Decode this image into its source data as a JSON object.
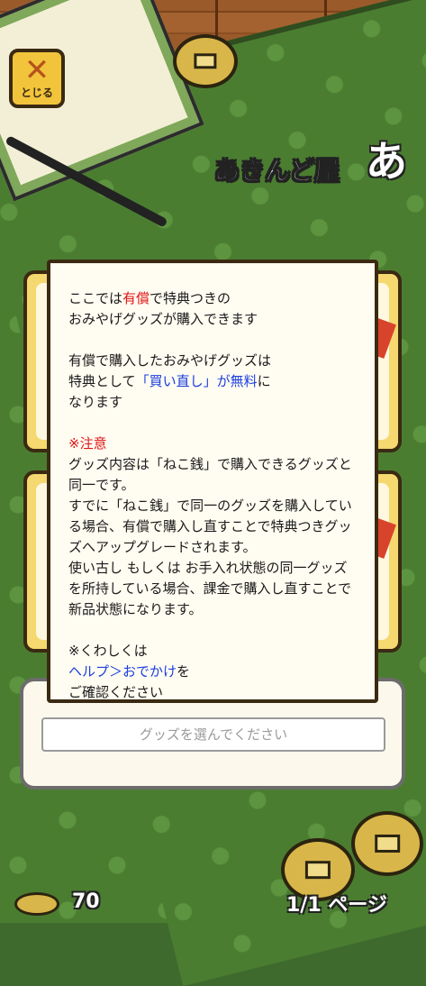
{
  "header": {
    "close_label": "とじる",
    "shop_title": "あきんど屋",
    "shop_logo": "あ"
  },
  "dialog": {
    "line1_a": "ここでは",
    "line1_red": "有償",
    "line1_b": "で特典つきの",
    "line2": "おみやげグッズが購入できます",
    "para2_line1": "有償で購入したおみやげグッズは",
    "para2_line2_a": "特典として",
    "para2_line2_blue": "「買い直し」が無料",
    "para2_line2_b": "に",
    "para2_line3": "なります",
    "warning_title": "※注意",
    "warning_body_1": "グッズ内容は「ねこ銭」で購入できるグッズと同一です。",
    "warning_body_2": "すでに「ねこ銭」で同一のグッズを購入している場合、有償で購入し直すことで特典つきグッズへアップグレードされます。",
    "warning_body_3": "使い古し もしくは お手入れ状態の同一グッズを所持している場合、課金で購入し直すことで新品状態になります。",
    "help_line1": "※くわしくは",
    "help_link": "ヘルプ＞おでかけ",
    "help_line2_tail": "を",
    "help_line3": "ご確認ください"
  },
  "bottom": {
    "choose_placeholder": "グッズを選んでください"
  },
  "footer": {
    "coin_count": "70",
    "page_indicator": "1/1 ページ"
  },
  "icons": {
    "close": "close-x-icon",
    "logo": "shop-logo-icon",
    "coin": "coin-icon"
  },
  "colors": {
    "wood": "#9a5a2a",
    "mat": "#4b7d31",
    "accent_red": "#e01414",
    "accent_blue": "#1a3ee0"
  }
}
